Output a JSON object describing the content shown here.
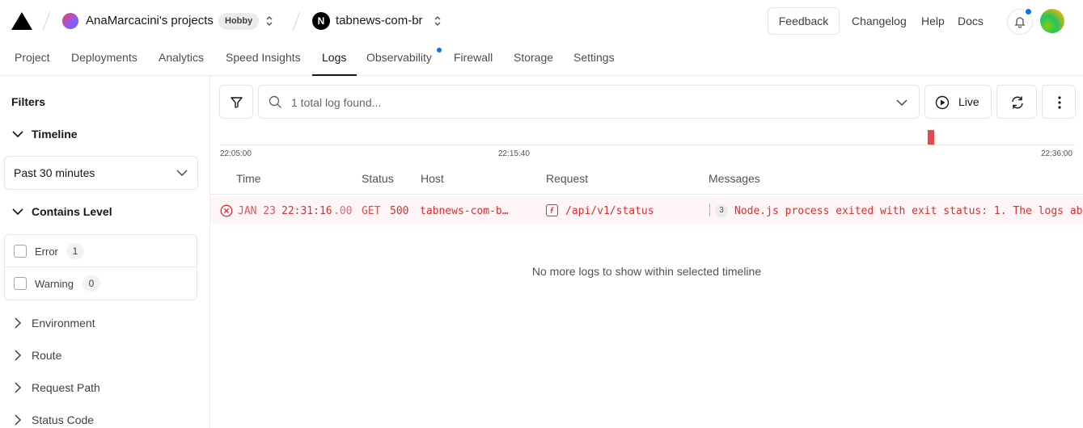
{
  "header": {
    "team_name": "AnaMarcacini's projects",
    "plan_badge": "Hobby",
    "project_icon_letter": "N",
    "project_name": "tabnews-com-br",
    "feedback_label": "Feedback",
    "links": [
      "Changelog",
      "Help",
      "Docs"
    ]
  },
  "tabs": [
    "Project",
    "Deployments",
    "Analytics",
    "Speed Insights",
    "Logs",
    "Observability",
    "Firewall",
    "Storage",
    "Settings"
  ],
  "active_tab": "Logs",
  "sidebar": {
    "title": "Filters",
    "timeline_label": "Timeline",
    "timeline_value": "Past 30 minutes",
    "contains_level_label": "Contains Level",
    "levels": [
      {
        "label": "Error",
        "count": "1"
      },
      {
        "label": "Warning",
        "count": "0"
      }
    ],
    "collapsed_sections": [
      "Environment",
      "Route",
      "Request Path",
      "Status Code"
    ]
  },
  "toolbar": {
    "search_placeholder": "1 total log found...",
    "live_label": "Live"
  },
  "timeline": {
    "ticks": [
      "22:05:00",
      "22:15:40",
      "22:36:00"
    ]
  },
  "table": {
    "columns": [
      "Time",
      "Status",
      "Host",
      "Request",
      "Messages"
    ],
    "rows": [
      {
        "date": "JAN 23",
        "time": "22:31:16",
        "ms": ".00",
        "method": "GET",
        "status": "500",
        "host": "tabnews-com-b…",
        "request": "/api/v1/status",
        "message_count": "3",
        "message": "Node.js process exited with exit status: 1. The logs ab"
      }
    ],
    "empty_message": "No more logs to show within selected timeline"
  },
  "colors": {
    "error": "#da2f35",
    "accent": "#0a72ef"
  }
}
